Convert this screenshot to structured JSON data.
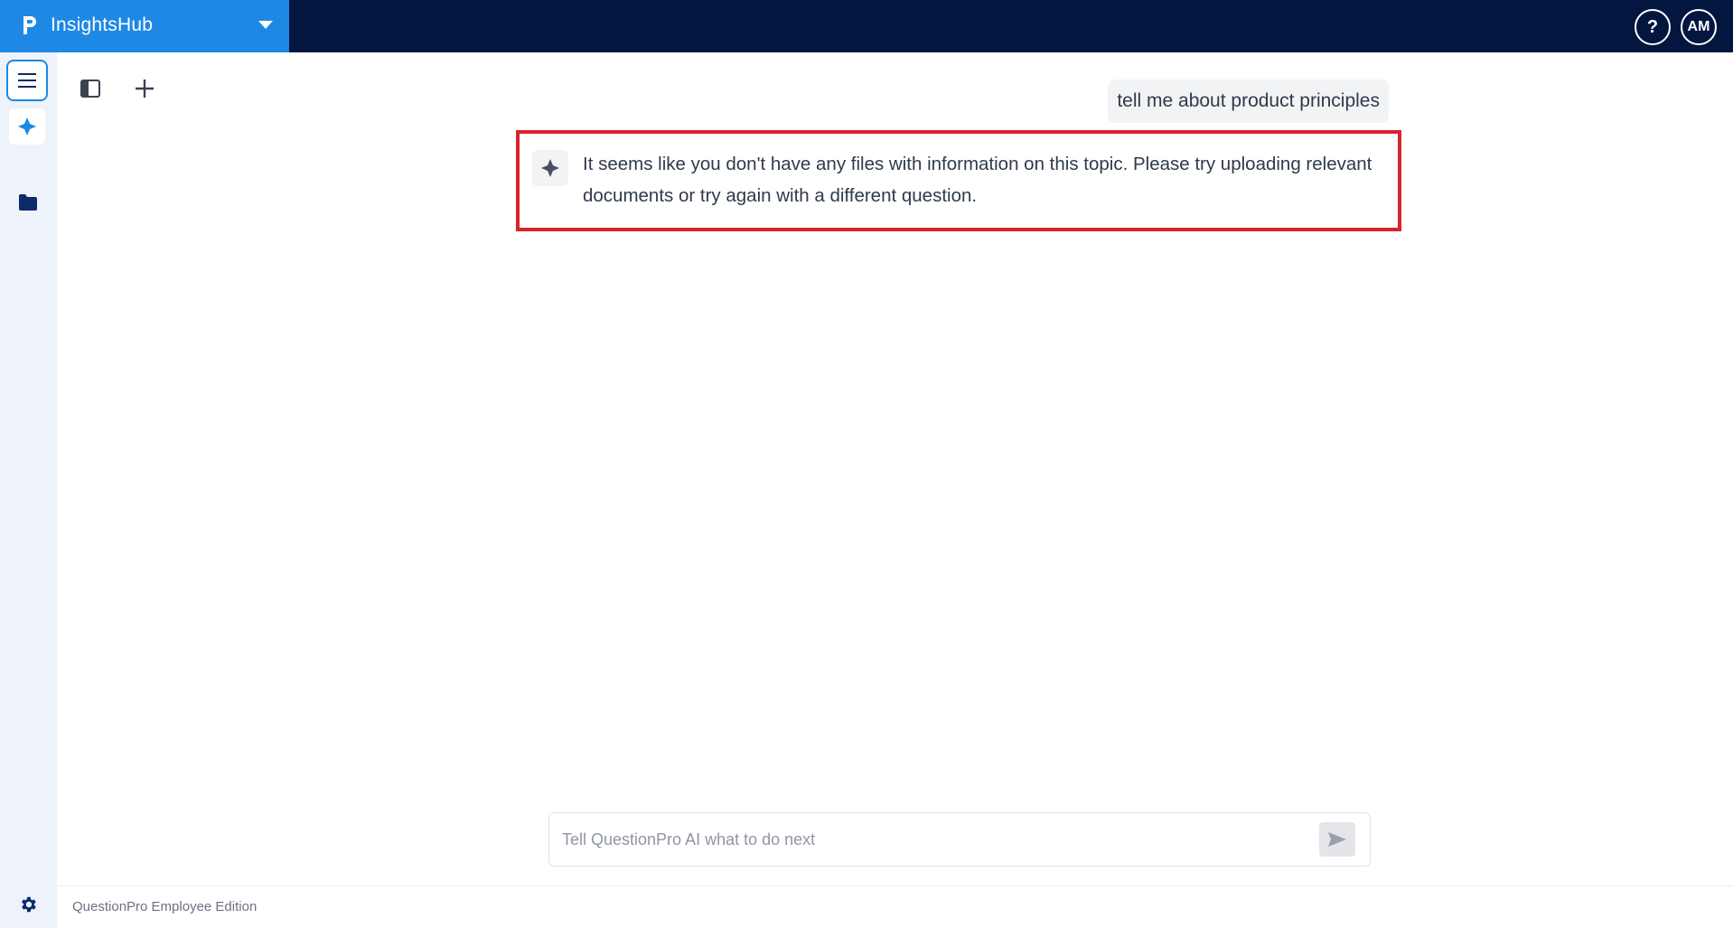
{
  "header": {
    "app_title": "InsightsHub",
    "help_label": "?",
    "avatar_initials": "AM",
    "brand_color": "#1e88e5",
    "bar_color": "#021640"
  },
  "sidebar": {
    "items": [
      {
        "icon": "hamburger-menu-icon",
        "active": true
      },
      {
        "icon": "sparkle-icon"
      },
      {
        "icon": "folder-icon"
      }
    ],
    "bottom_icon": "gear-icon"
  },
  "toolbar": {
    "icons": [
      "panel-toggle-icon",
      "plus-icon"
    ]
  },
  "chat": {
    "user_message": "tell me about product principles",
    "ai_response": "It seems like you don't have any files with information on this topic. Please try uploading relevant documents or try again with a different question.",
    "highlight_color": "#d9232e"
  },
  "input": {
    "placeholder": "Tell QuestionPro AI what to do next",
    "value": "",
    "send_icon": "send-icon"
  },
  "footer": {
    "text": "QuestionPro Employee Edition"
  }
}
